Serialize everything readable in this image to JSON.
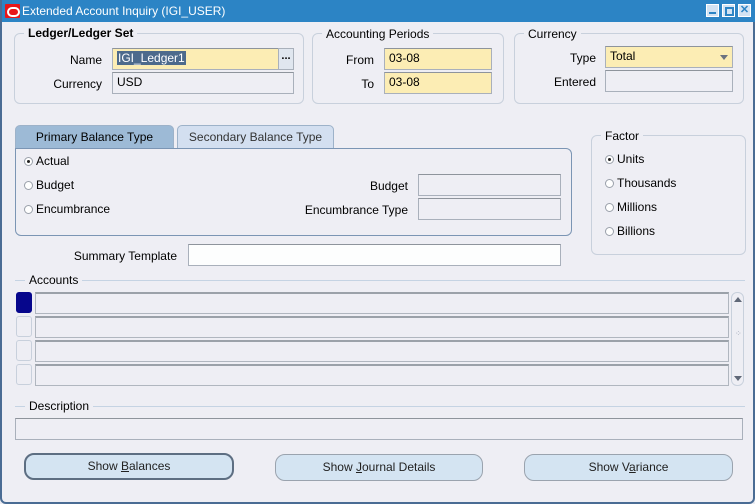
{
  "window": {
    "title": "Extended Account Inquiry (IGI_USER)",
    "controls": [
      "minimize-icon",
      "maximize-icon",
      "close-icon"
    ]
  },
  "ledger": {
    "group_label": "Ledger/Ledger Set",
    "name_label": "Name",
    "name_value": "IGI_Ledger1",
    "lov_label": "...",
    "currency_label": "Currency",
    "currency_value": "USD"
  },
  "periods": {
    "group_label": "Accounting Periods",
    "from_label": "From",
    "from_value": "03-08",
    "to_label": "To",
    "to_value": "03-08"
  },
  "currency": {
    "group_label": "Currency",
    "type_label": "Type",
    "type_value": "Total",
    "entered_label": "Entered",
    "entered_value": ""
  },
  "balance_tabs": [
    {
      "label": "Primary Balance Type",
      "active": true
    },
    {
      "label": "Secondary Balance Type",
      "active": false
    }
  ],
  "balance_type": {
    "options": [
      {
        "label": "Actual",
        "selected": true
      },
      {
        "label": "Budget",
        "selected": false
      },
      {
        "label": "Encumbrance",
        "selected": false
      }
    ],
    "budget_label": "Budget",
    "budget_value": "",
    "encumbrance_type_label": "Encumbrance Type",
    "encumbrance_type_value": ""
  },
  "factor": {
    "group_label": "Factor",
    "options": [
      {
        "label": "Units",
        "selected": true
      },
      {
        "label": "Thousands",
        "selected": false
      },
      {
        "label": "Millions",
        "selected": false
      },
      {
        "label": "Billions",
        "selected": false
      }
    ]
  },
  "summary_template": {
    "label": "Summary Template",
    "value": ""
  },
  "accounts": {
    "label": "Accounts",
    "rows": [
      "",
      "",
      "",
      ""
    ]
  },
  "description": {
    "label": "Description",
    "value": ""
  },
  "buttons": {
    "show_balances": {
      "pre": "Show ",
      "mnemonic": "B",
      "post": "alances"
    },
    "show_journal_details": {
      "pre": "Show ",
      "mnemonic": "J",
      "post": "ournal Details"
    },
    "show_variance": {
      "pre": "Show V",
      "mnemonic": "a",
      "post": "riance"
    }
  }
}
